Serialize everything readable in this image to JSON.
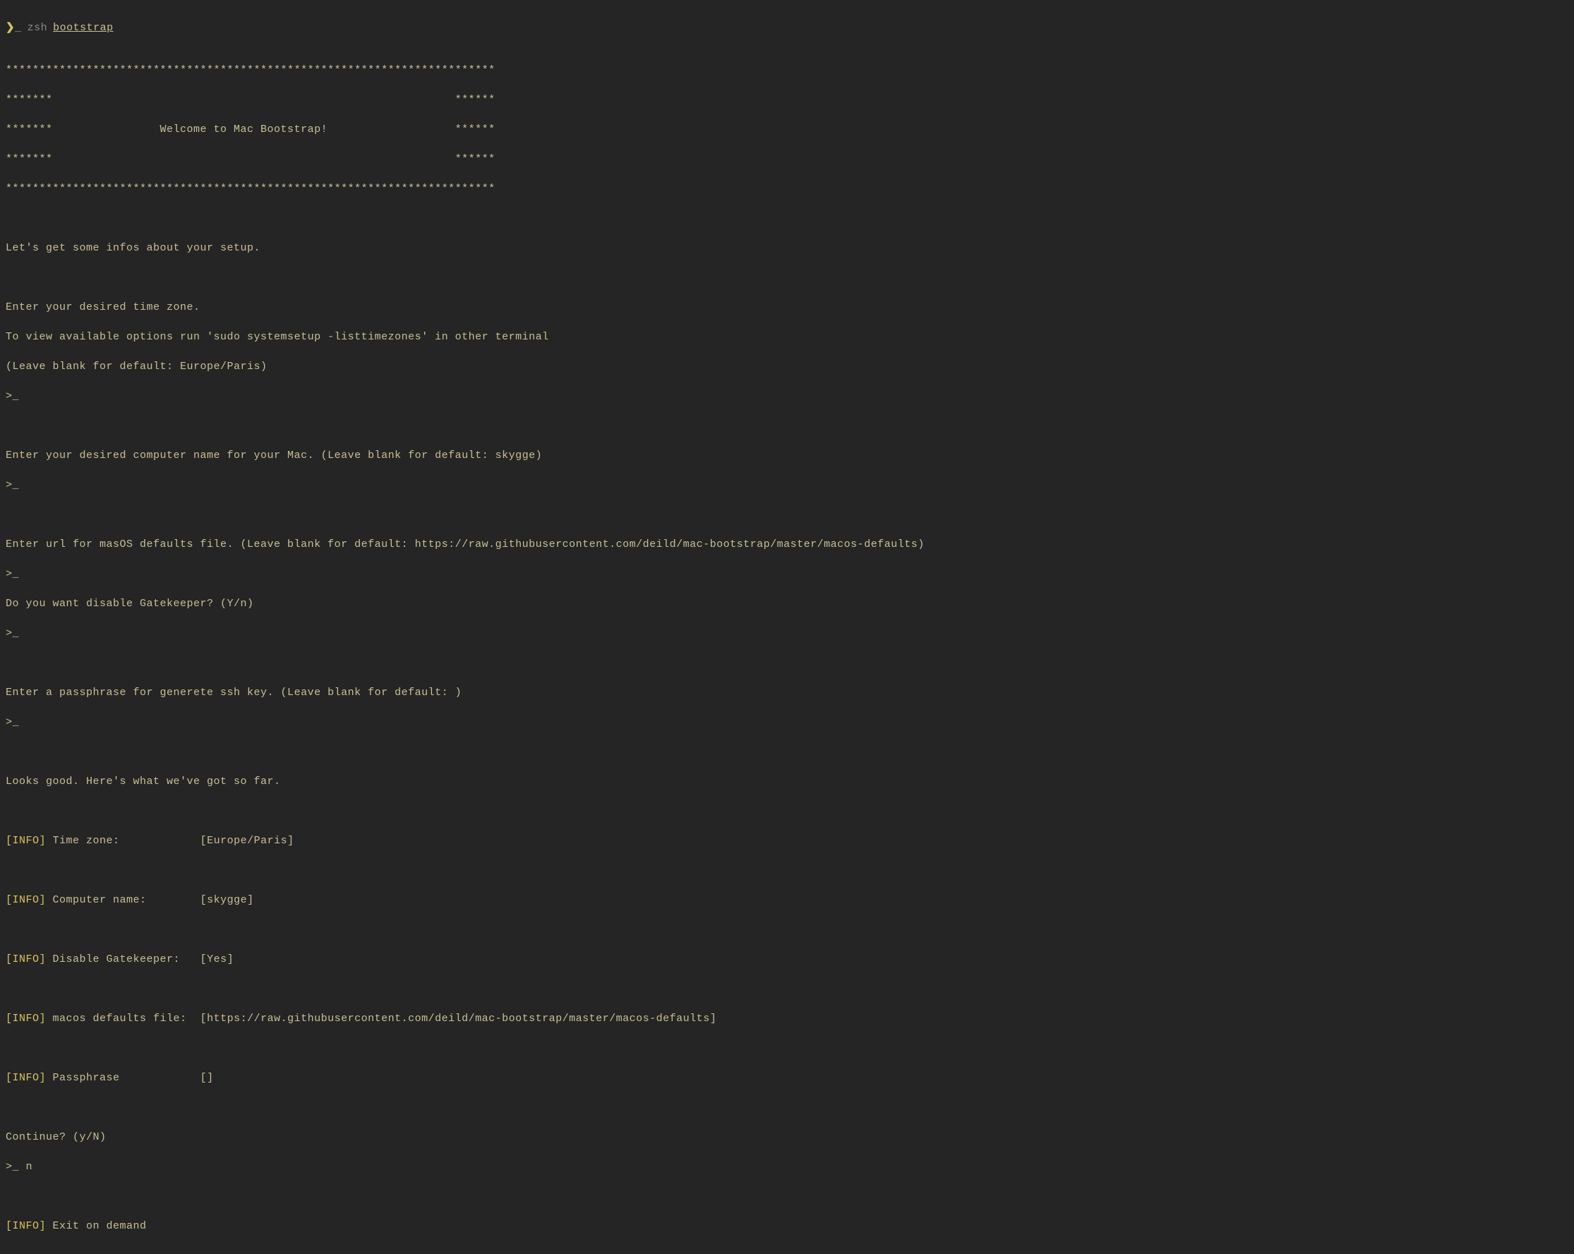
{
  "prompt": {
    "arrow": "❯",
    "underscore": "_",
    "shell": "zsh",
    "command": "bootstrap"
  },
  "banner": {
    "top": "*************************************************************************",
    "side1": "*******                                                            ******",
    "welcome": "*******                Welcome to Mac Bootstrap!                   ******",
    "side2": "*******                                                            ******",
    "bottom": "*************************************************************************"
  },
  "intro": "Let's get some infos about your setup.",
  "prompts": {
    "timezone": {
      "line1": "Enter your desired time zone.",
      "line2": "To view available options run 'sudo systemsetup -listtimezones' in other terminal",
      "line3": "(Leave blank for default: Europe/Paris)",
      "input": ">_"
    },
    "computername": {
      "line1": "Enter your desired computer name for your Mac. (Leave blank for default: skygge)",
      "input": ">_"
    },
    "defaultsfile": {
      "line1": "Enter url for masOS defaults file. (Leave blank for default: https://raw.githubusercontent.com/deild/mac-bootstrap/master/macos-defaults)",
      "input": ">_"
    },
    "gatekeeper": {
      "line1": "Do you want disable Gatekeeper? (Y/n)",
      "input": ">_"
    },
    "passphrase": {
      "line1": "Enter a passphrase for generete ssh key. (Leave blank for default: )",
      "input": ">_"
    }
  },
  "summary": {
    "header": "Looks good. Here's what we've got so far.",
    "infoTag": "[INFO]",
    "items": [
      {
        "label": "Time zone:          ",
        "value": "[Europe/Paris]"
      },
      {
        "label": "Computer name:      ",
        "value": "[skygge]"
      },
      {
        "label": "Disable Gatekeeper: ",
        "value": "[Yes]"
      },
      {
        "label": "macos defaults file:",
        "value": "[https://raw.githubusercontent.com/deild/mac-bootstrap/master/macos-defaults]"
      },
      {
        "label": "Passphrase          ",
        "value": "[]"
      }
    ]
  },
  "continue": {
    "prompt": "Continue? (y/N)",
    "input": ">_ n"
  },
  "exit": {
    "tag": "[INFO]",
    "text": "Exit on demand"
  }
}
